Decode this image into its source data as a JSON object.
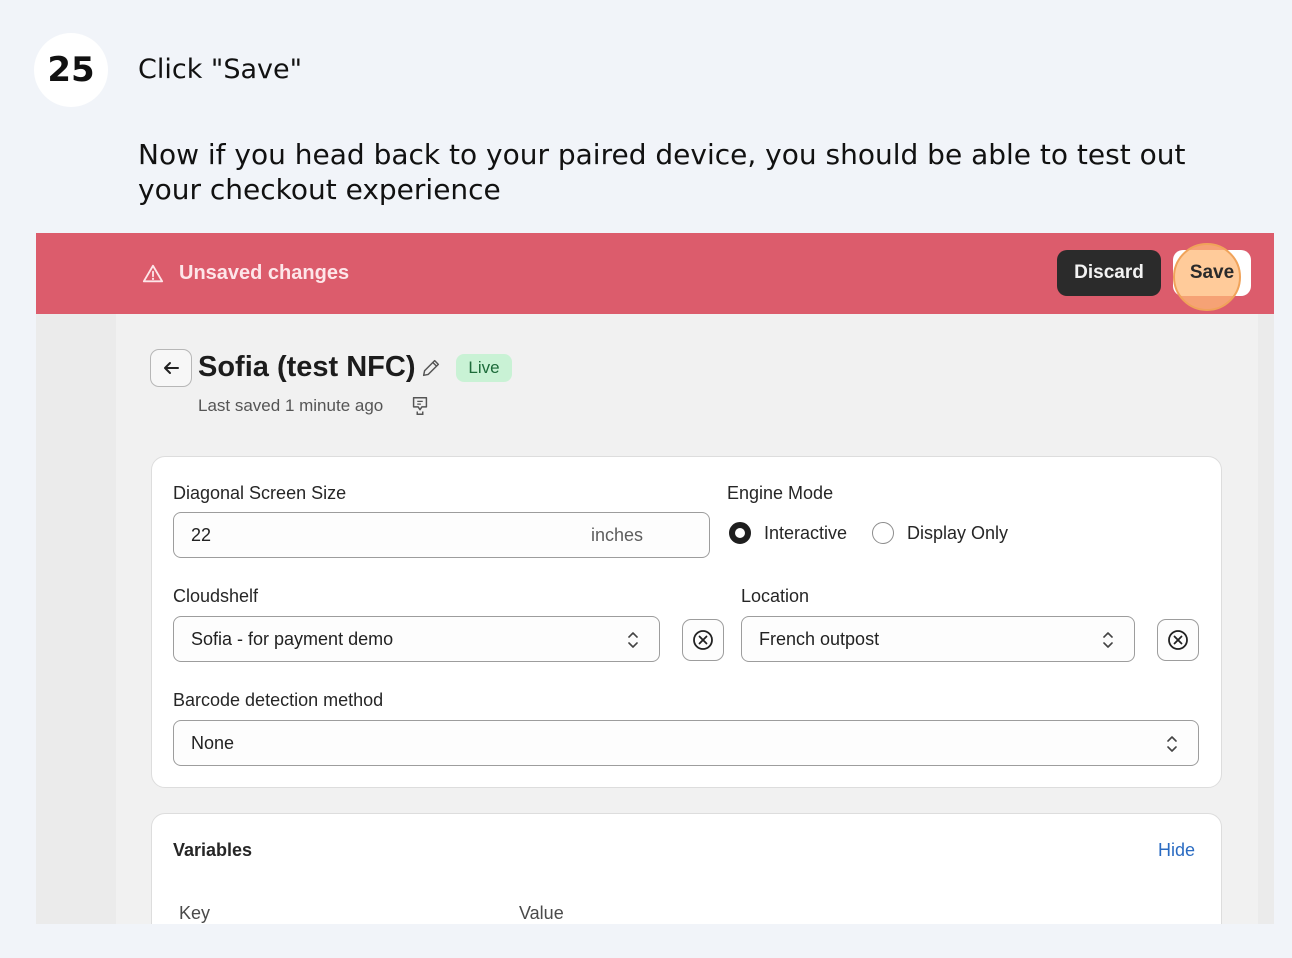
{
  "step": {
    "number": "25",
    "title": "Click \"Save\"",
    "description": "Now if you head back to your paired device, you should be able to test out your checkout experience"
  },
  "banner": {
    "message": "Unsaved changes",
    "icon": "warning-icon",
    "discard_label": "Discard",
    "save_label": "Save",
    "color": "#dc5c6c"
  },
  "page": {
    "title": "Sofia (test NFC)",
    "status_badge": "Live",
    "last_saved": "Last saved 1 minute ago"
  },
  "form": {
    "screen_size": {
      "label": "Diagonal Screen Size",
      "value": "22",
      "suffix": "inches"
    },
    "engine_mode": {
      "label": "Engine Mode",
      "options": [
        "Interactive",
        "Display Only"
      ],
      "selected": "Interactive"
    },
    "cloudshelf": {
      "label": "Cloudshelf",
      "value": "Sofia - for payment demo"
    },
    "location": {
      "label": "Location",
      "value": "French outpost"
    },
    "barcode": {
      "label": "Barcode detection method",
      "value": "None"
    }
  },
  "variables": {
    "title": "Variables",
    "toggle_label": "Hide",
    "columns": [
      "Key",
      "Value"
    ]
  }
}
